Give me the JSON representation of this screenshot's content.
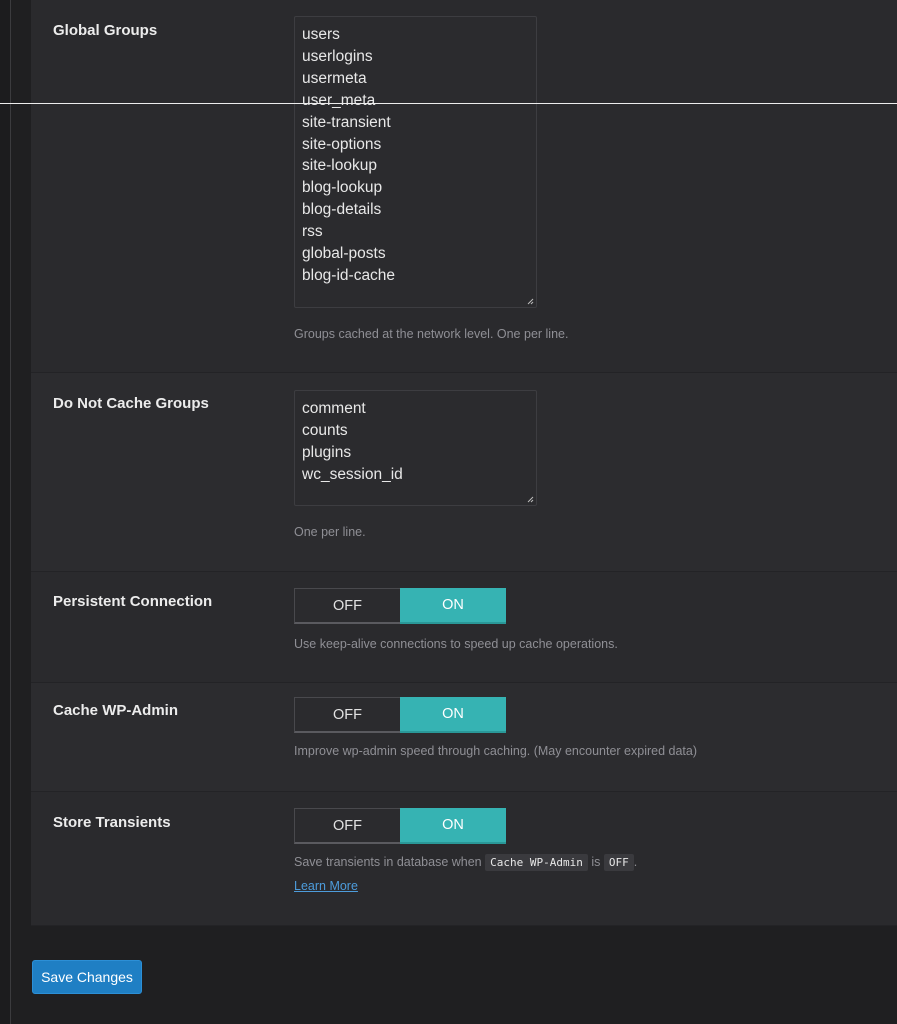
{
  "rows": {
    "global_groups": {
      "label": "Global Groups",
      "values": [
        "users",
        "userlogins",
        "usermeta",
        "user_meta",
        "site-transient",
        "site-options",
        "site-lookup",
        "blog-lookup",
        "blog-details",
        "rss",
        "global-posts",
        "blog-id-cache"
      ],
      "help": "Groups cached at the network level. One per line."
    },
    "do_not_cache": {
      "label": "Do Not Cache Groups",
      "values": [
        "comment",
        "counts",
        "plugins",
        "wc_session_id"
      ],
      "help": "One per line."
    },
    "persistent": {
      "label": "Persistent Connection",
      "off": "OFF",
      "on": "ON",
      "state": "ON",
      "help": "Use keep-alive connections to speed up cache operations."
    },
    "cache_admin": {
      "label": "Cache WP-Admin",
      "off": "OFF",
      "on": "ON",
      "state": "ON",
      "help": "Improve wp-admin speed through caching. (May encounter expired data)"
    },
    "transients": {
      "label": "Store Transients",
      "off": "OFF",
      "on": "ON",
      "state": "ON",
      "help_prefix": "Save transients in database when",
      "help_code1": "Cache WP-Admin",
      "help_mid": "is",
      "help_code2": "OFF",
      "help_suffix": ".",
      "learn_more": "Learn More"
    }
  },
  "save_button": "Save Changes",
  "colors": {
    "toggle_on": "#36b3b3",
    "primary_button": "#1f7fc4",
    "link": "#4d9cdb"
  }
}
